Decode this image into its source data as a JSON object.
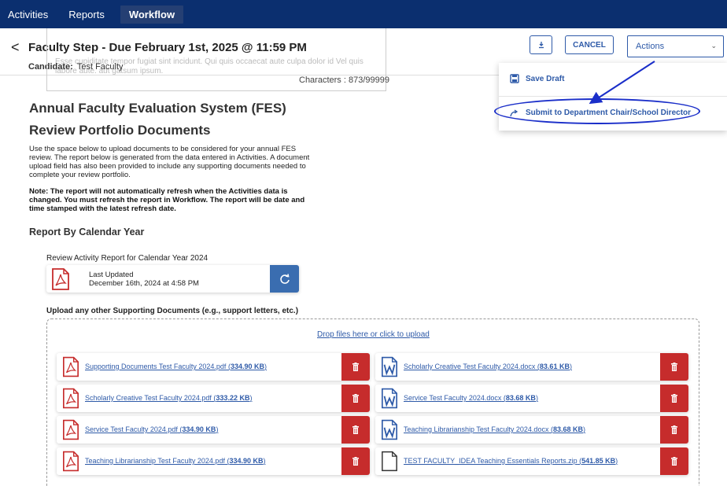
{
  "nav": {
    "tabs": [
      "Activities",
      "Reports",
      "Workflow"
    ]
  },
  "header": {
    "back_glyph": "<",
    "title": "Faculty Step - Due February 1st, 2025 @ 11:59 PM",
    "candidate_label": "Candidate:",
    "candidate_name": "Test Faculty",
    "ghost_text": "Esse cupiditate tempor fugiat sint incidunt. Qui quis occaecat aute culpa dolor id Vel quis labore aute. aut gatsum ipsum.",
    "characters": "Characters : 873/99999"
  },
  "toolbar": {
    "download_icon": "download-icon",
    "cancel_label": "CANCEL",
    "actions_label": "Actions",
    "actions_chevron": "⌄"
  },
  "actions_menu": {
    "items": [
      {
        "label": "Save Draft",
        "icon": "save-icon"
      },
      {
        "label": "Submit to Department Chair/School Director",
        "icon": "share-arrow-icon"
      }
    ],
    "highlight_color": "#1a2ec9"
  },
  "main": {
    "heading1": "Annual Faculty Evaluation System (FES)",
    "heading2": "Review Portfolio Documents",
    "description": "Use the space below to upload documents to be considered for your annual FES review. The report below is generated from the data entered in Activities. A document upload field has also been provided to include any supporting documents needed to complete your review portfolio.",
    "note": "Note: The report will not automatically refresh when the Activities data is changed. You must refresh the report in Workflow. The report will be date and time stamped with the latest refresh date.",
    "section_title": "Report By Calendar Year",
    "report_label": "Review Activity Report for Calendar Year 2024",
    "report_updated_label": "Last Updated",
    "report_updated_date": "December 16th, 2024 at 4:58 PM",
    "upload_label": "Upload any other Supporting Documents (e.g., support letters, etc.)",
    "drop_text": "Drop files here or click to upload"
  },
  "files": {
    "left": [
      {
        "name": "Supporting Documents Test Faculty 2024.pdf",
        "size": "334.90 KB",
        "type": "pdf"
      },
      {
        "name": "Scholarly Creative Test Faculty 2024.pdf",
        "size": "333.22 KB",
        "type": "pdf"
      },
      {
        "name": "Service Test Faculty 2024.pdf",
        "size": "334.90 KB",
        "type": "pdf"
      },
      {
        "name": "Teaching Librarianship Test Faculty 2024.pdf",
        "size": "334.90 KB",
        "type": "pdf"
      }
    ],
    "right": [
      {
        "name": "Scholarly Creative Test Faculty 2024.docx",
        "size": "83.61 KB",
        "type": "word"
      },
      {
        "name": "Service Test Faculty 2024.docx",
        "size": "83.68 KB",
        "type": "word"
      },
      {
        "name": "Teaching Librarianship Test Faculty 2024.docx",
        "size": "83.68 KB",
        "type": "word"
      },
      {
        "name": "TEST FACULTY_IDEA Teaching Essentials Reports.zip",
        "size": "541.85 KB",
        "type": "file"
      }
    ]
  },
  "colors": {
    "nav_bg": "#0b2f6f",
    "primary": "#2e5aa8",
    "delete": "#c62c2c",
    "refresh": "#3a6db0",
    "pdf": "#c62c2c"
  }
}
